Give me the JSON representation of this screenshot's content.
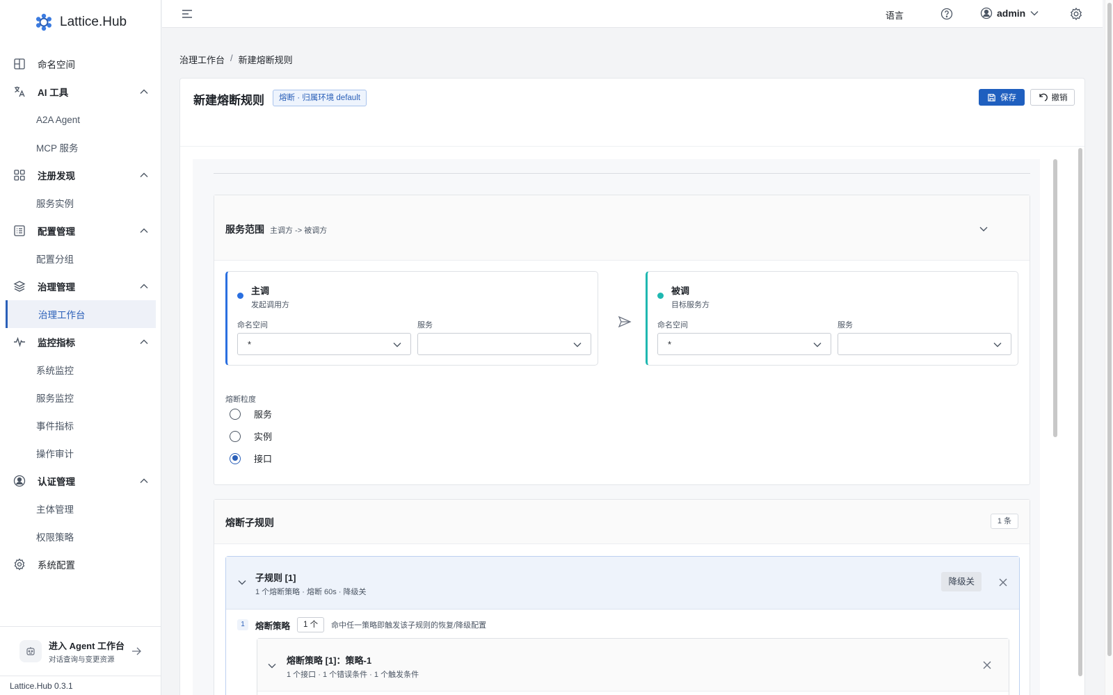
{
  "brand": {
    "name": "Lattice.Hub"
  },
  "sidebar": {
    "items": [
      {
        "label": "命名空间",
        "icon": "namespace-icon"
      },
      {
        "label": "AI 工具",
        "icon": "translate-icon",
        "expanded": true,
        "children": [
          "A2A Agent",
          "MCP 服务"
        ]
      },
      {
        "label": "注册发现",
        "icon": "grid-icon",
        "expanded": true,
        "children": [
          "服务实例"
        ]
      },
      {
        "label": "配置管理",
        "icon": "list-icon",
        "expanded": true,
        "children": [
          "配置分组"
        ]
      },
      {
        "label": "治理管理",
        "icon": "layers-icon",
        "expanded": true,
        "children": [
          "治理工作台"
        ]
      },
      {
        "label": "监控指标",
        "icon": "pulse-icon",
        "expanded": true,
        "children": [
          "系统监控",
          "服务监控",
          "事件指标",
          "操作审计"
        ]
      },
      {
        "label": "认证管理",
        "icon": "user-circle-icon",
        "expanded": true,
        "children": [
          "主体管理",
          "权限策略"
        ]
      },
      {
        "label": "系统配置",
        "icon": "gear-icon"
      }
    ],
    "active": "治理工作台",
    "agent_entry": {
      "title": "进入 Agent 工作台",
      "subtitle": "对话查询与变更资源"
    },
    "version": "Lattice.Hub 0.3.1"
  },
  "header": {
    "language": "语言",
    "user": "admin"
  },
  "breadcrumb": {
    "parent": "治理工作台",
    "separator": "/",
    "current": "新建熔断规则"
  },
  "page": {
    "title": "新建熔断规则",
    "tag": "熔断 · 归属环境 default",
    "save_label": "保存",
    "undo_label": "撤销"
  },
  "scope": {
    "title": "服务范围",
    "subtitle": "主调方 -> 被调方",
    "caller": {
      "name": "主调",
      "desc": "发起调用方",
      "namespace_label": "命名空间",
      "namespace_value": "*",
      "service_label": "服务",
      "service_value": ""
    },
    "callee": {
      "name": "被调",
      "desc": "目标服务方",
      "namespace_label": "命名空间",
      "namespace_value": "*",
      "service_label": "服务",
      "service_value": ""
    },
    "granularity_label": "熔断粒度",
    "granularity_options": [
      "服务",
      "实例",
      "接口"
    ],
    "granularity_selected": "接口",
    "colors": {
      "caller": "#2a6fe0",
      "callee": "#1fb8b1",
      "primary": "#1f5fbf"
    }
  },
  "sub_rules": {
    "title": "熔断子规则",
    "count": "1 条",
    "rule": {
      "title": "子规则 [1]",
      "meta": "1 个熔断策略 · 熔断 60s · 降级关",
      "degrade_tag": "降级关",
      "index": "1",
      "strategy_label": "熔断策略",
      "strategy_count": "1 个",
      "strategy_hint": "命中任一策略即触发该子规则的恢复/降级配置",
      "strategy": {
        "title": "熔断策略 [1]：策略-1",
        "meta": "1 个接口 · 1 个错误条件 · 1 个触发条件"
      }
    }
  }
}
